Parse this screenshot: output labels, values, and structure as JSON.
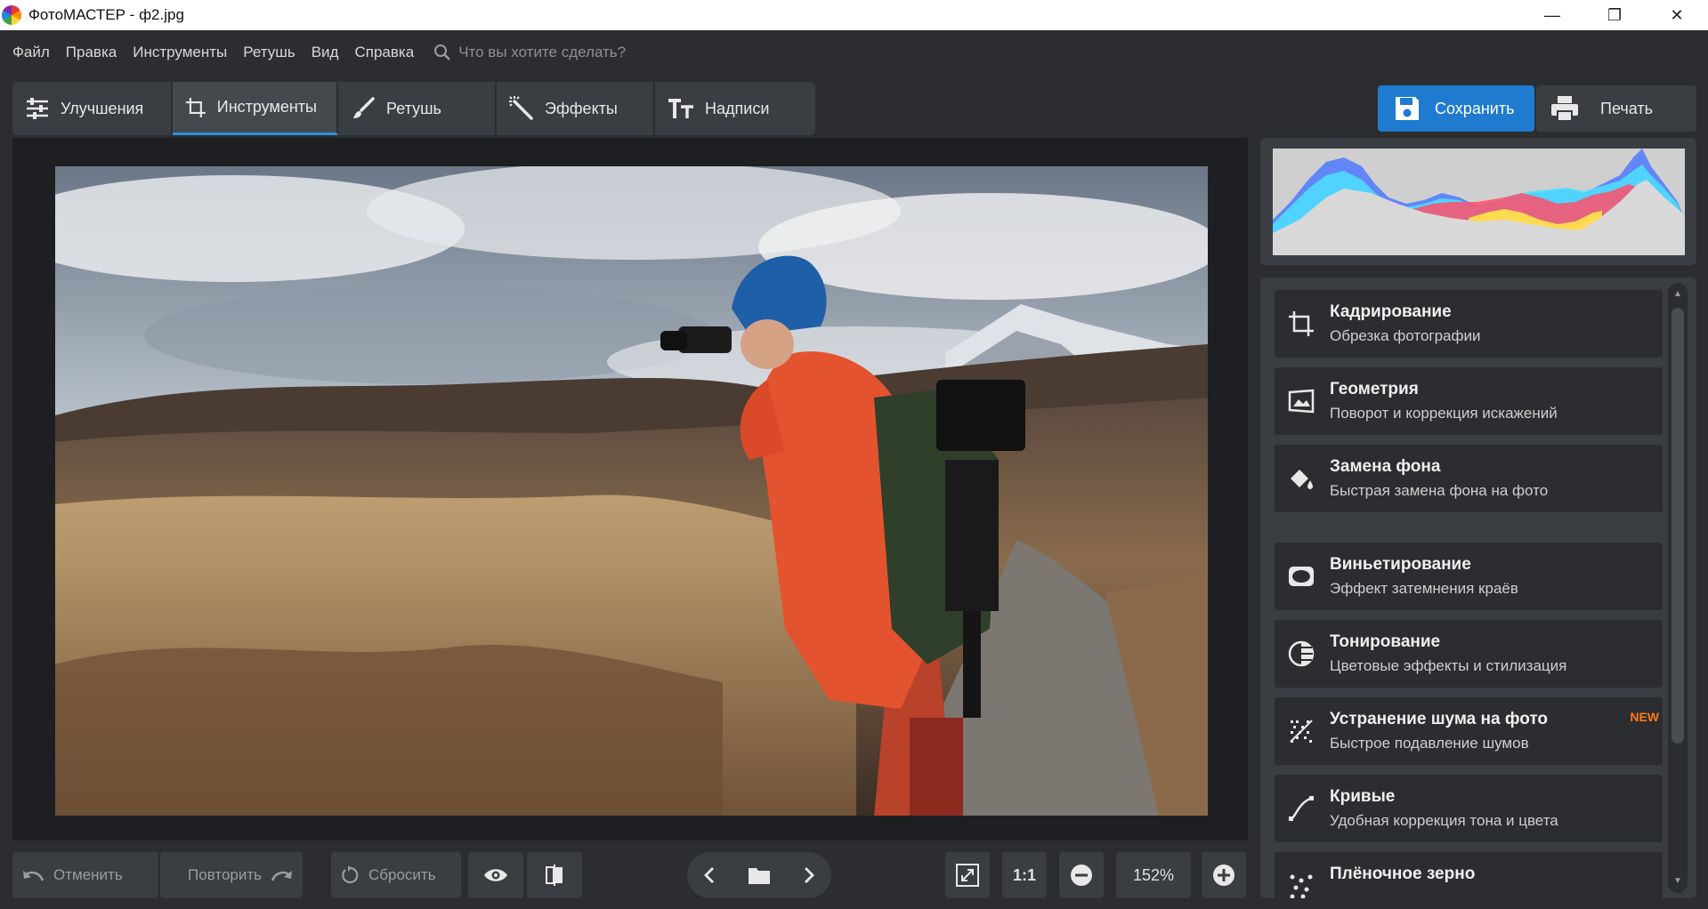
{
  "window": {
    "title": "ФотоМАСТЕР - ф2.jpg",
    "min_glyph": "—",
    "max_glyph": "❐",
    "close_glyph": "✕"
  },
  "menu": {
    "items": [
      "Файл",
      "Правка",
      "Инструменты",
      "Ретушь",
      "Вид",
      "Справка"
    ],
    "search_placeholder": "Что вы хотите сделать?"
  },
  "tabs": [
    {
      "label": "Улучшения",
      "icon": "sliders-icon",
      "active": false
    },
    {
      "label": "Инструменты",
      "icon": "crop-icon",
      "active": true
    },
    {
      "label": "Ретушь",
      "icon": "brush-icon",
      "active": false
    },
    {
      "label": "Эффекты",
      "icon": "magic-wand-icon",
      "active": false
    },
    {
      "label": "Надписи",
      "icon": "text-icon",
      "active": false
    }
  ],
  "actions": {
    "save_label": "Сохранить",
    "print_label": "Печать"
  },
  "tools": [
    {
      "name": "Кадрирование",
      "desc": "Обрезка фотографии",
      "icon": "crop-icon",
      "badge": ""
    },
    {
      "name": "Геометрия",
      "desc": "Поворот и коррекция искажений",
      "icon": "geometry-icon",
      "badge": ""
    },
    {
      "name": "Замена фона",
      "desc": "Быстрая замена фона на фото",
      "icon": "paint-bucket-icon",
      "badge": ""
    },
    {
      "name": "Виньетирование",
      "desc": "Эффект затемнения краёв",
      "icon": "vignette-icon",
      "badge": ""
    },
    {
      "name": "Тонирование",
      "desc": "Цветовые эффекты и стилизация",
      "icon": "toning-icon",
      "badge": ""
    },
    {
      "name": "Устранение шума на фото",
      "desc": "Быстрое подавление шумов",
      "icon": "noise-icon",
      "badge": "NEW"
    },
    {
      "name": "Кривые",
      "desc": "Удобная коррекция тона и цвета",
      "icon": "curves-icon",
      "badge": ""
    },
    {
      "name": "Плёночное зерно",
      "desc": "",
      "icon": "grain-icon",
      "badge": ""
    }
  ],
  "bottom": {
    "undo_label": "Отменить",
    "redo_label": "Повторить",
    "reset_label": "Сбросить",
    "zoom_1to1": "1:1",
    "zoom_value": "152%"
  },
  "colors": {
    "accent": "#1f7bd0",
    "badge": "#ff7a1a",
    "panel": "#3a3d41",
    "background": "#2b2d30"
  }
}
